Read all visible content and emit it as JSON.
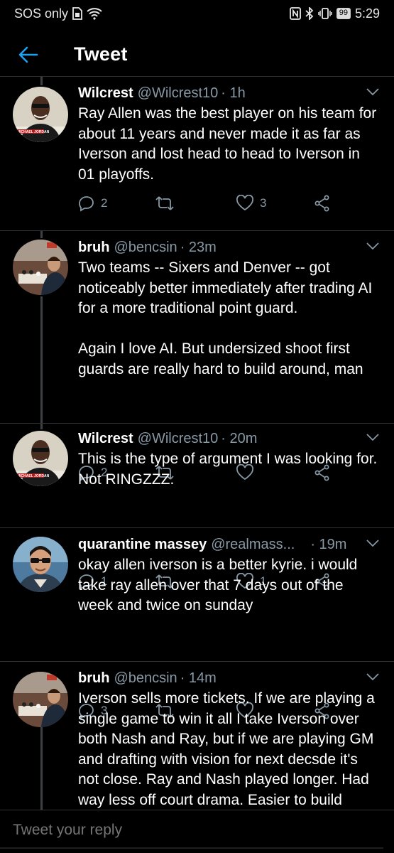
{
  "status": {
    "carrier": "SOS only",
    "battery": "99",
    "time": "5:29"
  },
  "header": {
    "title": "Tweet"
  },
  "tweets": [
    {
      "name": "Wilcrest",
      "handle": "@Wilcrest10",
      "time": "· 1h",
      "text": "Ray Allen was the best player on his team for about 11 years and never made it as far as Iverson and lost head to head to Iverson in 01 playoffs.",
      "replies": "2",
      "retweets": "",
      "likes": "3",
      "avatar": "jordan"
    },
    {
      "name": "bruh",
      "handle": "@bencsin",
      "time": "· 23m",
      "text": "Two teams -- Sixers and Denver -- got noticeably better immediately after trading AI for a more traditional point guard.\n\nAgain I love AI. But undersized shoot first guards are really hard to build around, man",
      "replies": "2",
      "retweets": "",
      "likes": "",
      "avatar": "chess"
    },
    {
      "name": "Wilcrest",
      "handle": "@Wilcrest10",
      "time": "· 20m",
      "text": "This is the type of argument I was looking for.  Not RINGZZZ.",
      "replies": "1",
      "retweets": "",
      "likes": "1",
      "avatar": "jordan"
    },
    {
      "name": "quarantine massey",
      "handle": "@realmass...",
      "time": "· 19m",
      "text": "okay allen iverson is a better kyrie. i would take ray allen over that 7 days out of the week and twice on sunday",
      "replies": "3",
      "retweets": "",
      "likes": "",
      "avatar": "glasses"
    },
    {
      "name": "bruh",
      "handle": "@bencsin",
      "time": "· 14m",
      "text": "Iverson sells more tickets. If we are playing a single game to win it all I take Iverson over both Nash and Ray, but if we are playing GM and drafting with vision for next decsde it's not close. Ray and Nash played longer. Had way less off court drama. Easier to build",
      "replies": "",
      "retweets": "",
      "likes": "",
      "avatar": "chess"
    }
  ],
  "avatar_captions": {
    "jordan": "MICHAEL JORDAN"
  },
  "reply": {
    "placeholder": "Tweet your reply"
  },
  "colors": {
    "accent": "#1da1f2",
    "muted": "#8899a6",
    "background": "#000000"
  }
}
